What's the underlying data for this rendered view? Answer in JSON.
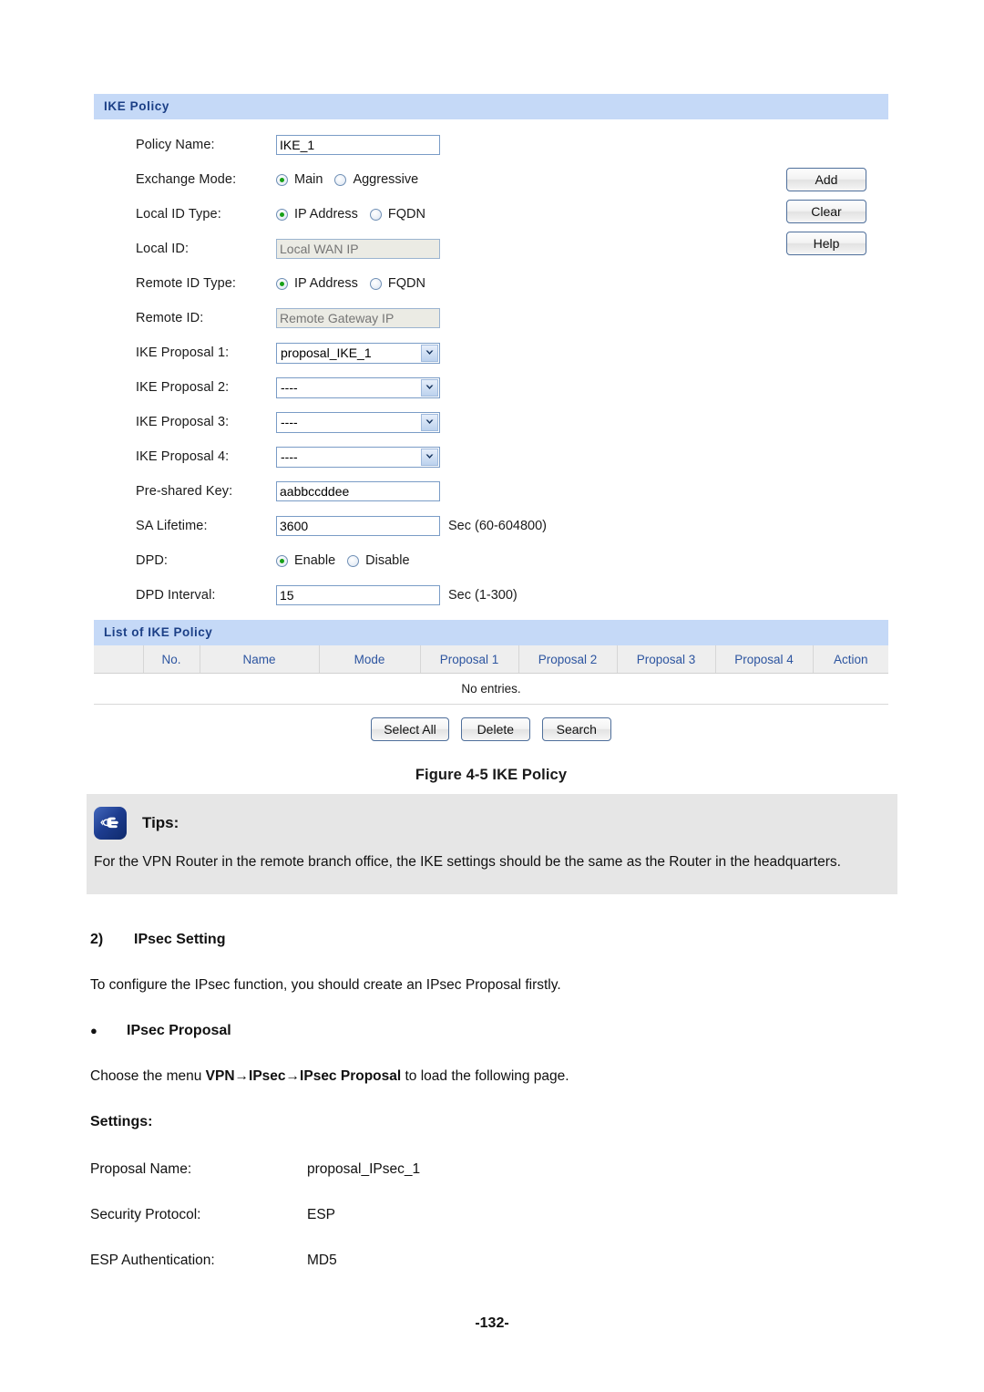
{
  "figure": {
    "panel_title": "IKE Policy",
    "fields": {
      "policy_name_label": "Policy Name:",
      "policy_name_value": "IKE_1",
      "exchange_mode_label": "Exchange Mode:",
      "exchange_mode_options": [
        "Main",
        "Aggressive"
      ],
      "exchange_mode_selected": "Main",
      "local_id_type_label": "Local ID Type:",
      "local_id_type_options": [
        "IP Address",
        "FQDN"
      ],
      "local_id_type_selected": "IP Address",
      "local_id_label": "Local ID:",
      "local_id_placeholder": "Local WAN IP",
      "remote_id_type_label": "Remote ID Type:",
      "remote_id_type_options": [
        "IP Address",
        "FQDN"
      ],
      "remote_id_type_selected": "IP Address",
      "remote_id_label": "Remote ID:",
      "remote_id_placeholder": "Remote Gateway IP",
      "ike_proposal_1_label": "IKE Proposal 1:",
      "ike_proposal_1_value": "proposal_IKE_1",
      "ike_proposal_2_label": "IKE Proposal 2:",
      "ike_proposal_2_value": "----",
      "ike_proposal_3_label": "IKE Proposal 3:",
      "ike_proposal_3_value": "----",
      "ike_proposal_4_label": "IKE Proposal 4:",
      "ike_proposal_4_value": "----",
      "pre_shared_key_label": "Pre-shared Key:",
      "pre_shared_key_value": "aabbccddee",
      "sa_lifetime_label": "SA Lifetime:",
      "sa_lifetime_value": "3600",
      "sa_lifetime_hint": "Sec (60-604800)",
      "dpd_label": "DPD:",
      "dpd_options": [
        "Enable",
        "Disable"
      ],
      "dpd_selected": "Enable",
      "dpd_interval_label": "DPD Interval:",
      "dpd_interval_value": "15",
      "dpd_interval_hint": "Sec (1-300)"
    },
    "side_buttons": [
      "Add",
      "Clear",
      "Help"
    ],
    "list": {
      "title": "List of IKE Policy",
      "columns": [
        "",
        "No.",
        "Name",
        "Mode",
        "Proposal 1",
        "Proposal 2",
        "Proposal 3",
        "Proposal 4",
        "Action"
      ],
      "empty_text": "No entries.",
      "actions": [
        "Select All",
        "Delete",
        "Search"
      ]
    },
    "caption": "Figure 4-5 IKE Policy"
  },
  "tips": {
    "icon": "pointing-hand-icon",
    "title": "Tips:",
    "body": "For the VPN Router in the remote branch office, the IKE settings should be the same as the Router in the headquarters."
  },
  "document": {
    "section_number": "2)",
    "section_title": "IPsec Setting",
    "intro": "To configure the IPsec function, you should create an IPsec Proposal firstly.",
    "bullet_marker": "●",
    "bullet_title": "IPsec Proposal",
    "menu_sentence_prefix": "Choose the menu ",
    "menu_path": "VPN→IPsec→IPsec Proposal",
    "menu_sentence_suffix": " to load the following page.",
    "settings_heading": "Settings:",
    "settings": [
      {
        "key": "Proposal Name:",
        "value": "proposal_IPsec_1"
      },
      {
        "key": "Security Protocol:",
        "value": "ESP"
      },
      {
        "key": "ESP Authentication:",
        "value": "MD5"
      }
    ]
  },
  "footer": {
    "page_number": "-132-"
  }
}
